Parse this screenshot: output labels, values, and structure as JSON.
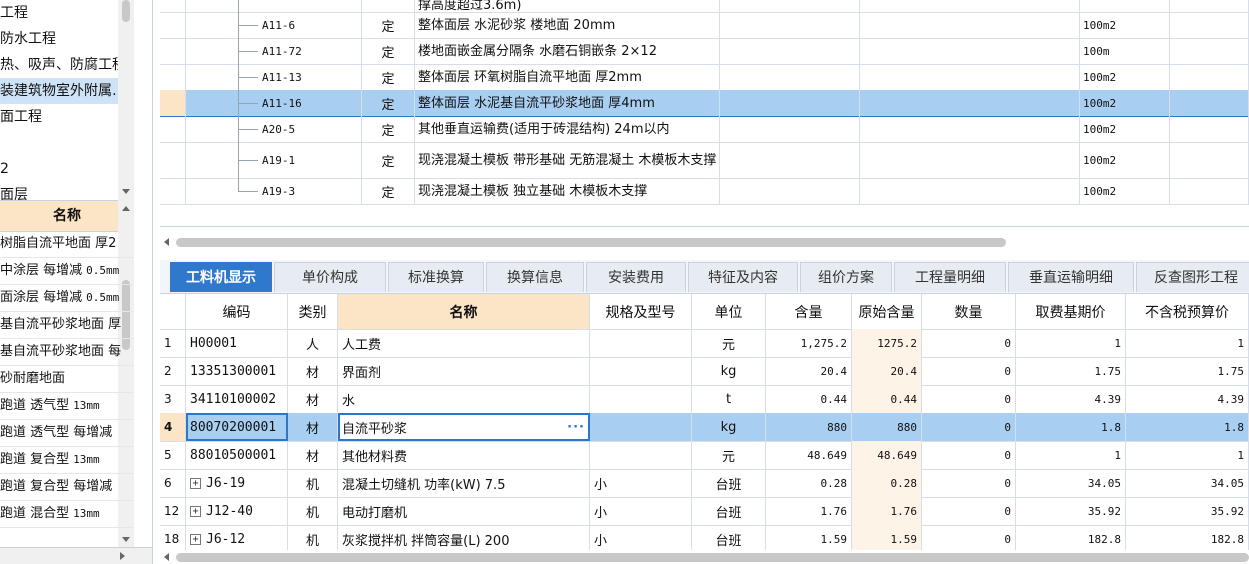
{
  "left_tree": {
    "items": [
      {
        "label": "工程",
        "selected": false
      },
      {
        "label": "防水工程",
        "selected": false
      },
      {
        "label": "热、吸声、防腐工程",
        "selected": false
      },
      {
        "label": "装建筑物室外附属…",
        "selected": true
      },
      {
        "label": "面工程",
        "selected": false
      },
      {
        "label": "",
        "selected": false
      },
      {
        "label": "2",
        "selected": false
      },
      {
        "label": "面层",
        "selected": false
      }
    ]
  },
  "left_list": {
    "header": "名称",
    "items": [
      {
        "text": "树脂自流平地面 厚2",
        "unit": ""
      },
      {
        "text": "中涂层 每增减",
        "unit": "0.5mm"
      },
      {
        "text": "面涂层 每增减",
        "unit": "0.5mm"
      },
      {
        "text": "基自流平砂浆地面 厚",
        "unit": ""
      },
      {
        "text": "基自流平砂浆地面 每",
        "unit": ""
      },
      {
        "text": "砂耐磨地面",
        "unit": ""
      },
      {
        "text": "跑道 透气型",
        "unit": "13mm"
      },
      {
        "text": "跑道 透气型 每增减",
        "unit": ""
      },
      {
        "text": "跑道 复合型",
        "unit": "13mm"
      },
      {
        "text": "跑道 复合型 每增减",
        "unit": ""
      },
      {
        "text": "跑道 混合型",
        "unit": "13mm"
      }
    ]
  },
  "top_grid": {
    "rows": [
      {
        "code": "",
        "type": "",
        "name": "撑高度超过3.6m)",
        "unit": "",
        "selected": false
      },
      {
        "code": "A11-6",
        "type": "定",
        "name": "整体面层 水泥砂浆 楼地面 20mm",
        "unit": "100m2",
        "selected": false
      },
      {
        "code": "A11-72",
        "type": "定",
        "name": "楼地面嵌金属分隔条 水磨石铜嵌条 2×12",
        "unit": "100m",
        "selected": false
      },
      {
        "code": "A11-13",
        "type": "定",
        "name": "整体面层 环氧树脂自流平地面 厚2mm",
        "unit": "100m2",
        "selected": false
      },
      {
        "code": "A11-16",
        "type": "定",
        "name": "整体面层 水泥基自流平砂浆地面 厚4mm",
        "unit": "100m2",
        "selected": true
      },
      {
        "code": "A20-5",
        "type": "定",
        "name": "其他垂直运输费(适用于砖混结构) 24m以内",
        "unit": "100m2",
        "selected": false
      },
      {
        "code": "A19-1",
        "type": "定",
        "name": "现浇混凝土模板 带形基础 无筋混凝土 木模板木支撑",
        "unit": "100m2",
        "selected": false
      },
      {
        "code": "A19-3",
        "type": "定",
        "name": "现浇混凝土模板 独立基础 木模板木支撑",
        "unit": "100m2",
        "selected": false
      }
    ]
  },
  "tabs": [
    {
      "label": "工料机显示",
      "active": true
    },
    {
      "label": "单价构成",
      "active": false
    },
    {
      "label": "标准换算",
      "active": false
    },
    {
      "label": "换算信息",
      "active": false
    },
    {
      "label": "安装费用",
      "active": false
    },
    {
      "label": "特征及内容",
      "active": false
    },
    {
      "label": "组价方案",
      "active": false
    },
    {
      "label": "工程量明细",
      "active": false
    },
    {
      "label": "垂直运输明细",
      "active": false
    },
    {
      "label": "反查图形工程",
      "active": false
    }
  ],
  "bottom_grid": {
    "headers": {
      "code": "编码",
      "category": "类别",
      "name": "名称",
      "spec": "规格及型号",
      "unit": "单位",
      "content": "含量",
      "orig_content": "原始含量",
      "qty": "数量",
      "base_price": "取费基期价",
      "pretax_price": "不含税预算价"
    },
    "rows": [
      {
        "num": "1",
        "expand": false,
        "code": "H00001",
        "category": "人",
        "name": "人工费",
        "spec": "",
        "unit": "元",
        "content": "1,275.2",
        "orig_content": "1275.2",
        "qty": "0",
        "base_price": "1",
        "pretax_price": "1",
        "selected": false
      },
      {
        "num": "2",
        "expand": false,
        "code": "13351300001",
        "category": "材",
        "name": "界面剂",
        "spec": "",
        "unit": "kg",
        "content": "20.4",
        "orig_content": "20.4",
        "qty": "0",
        "base_price": "1.75",
        "pretax_price": "1.75",
        "selected": false
      },
      {
        "num": "3",
        "expand": false,
        "code": "34110100002",
        "category": "材",
        "name": "水",
        "spec": "",
        "unit": "t",
        "content": "0.44",
        "orig_content": "0.44",
        "qty": "0",
        "base_price": "4.39",
        "pretax_price": "4.39",
        "selected": false
      },
      {
        "num": "4",
        "expand": false,
        "code": "80070200001",
        "category": "材",
        "name": "自流平砂浆",
        "spec": "",
        "unit": "kg",
        "content": "880",
        "orig_content": "880",
        "qty": "0",
        "base_price": "1.8",
        "pretax_price": "1.8",
        "selected": true
      },
      {
        "num": "5",
        "expand": false,
        "code": "88010500001",
        "category": "材",
        "name": "其他材料费",
        "spec": "",
        "unit": "元",
        "content": "48.649",
        "orig_content": "48.649",
        "qty": "0",
        "base_price": "1",
        "pretax_price": "1",
        "selected": false
      },
      {
        "num": "6",
        "expand": true,
        "code": "J6-19",
        "category": "机",
        "name": "混凝土切缝机 功率(kW) 7.5",
        "spec": "小",
        "unit": "台班",
        "content": "0.28",
        "orig_content": "0.28",
        "qty": "0",
        "base_price": "34.05",
        "pretax_price": "34.05",
        "selected": false
      },
      {
        "num": "12",
        "expand": true,
        "code": "J12-40",
        "category": "机",
        "name": "电动打磨机",
        "spec": "小",
        "unit": "台班",
        "content": "1.76",
        "orig_content": "1.76",
        "qty": "0",
        "base_price": "35.92",
        "pretax_price": "35.92",
        "selected": false
      },
      {
        "num": "18",
        "expand": true,
        "code": "J6-12",
        "category": "机",
        "name": "灰浆搅拌机 拌筒容量(L) 200",
        "spec": "小",
        "unit": "台班",
        "content": "1.59",
        "orig_content": "1.59",
        "qty": "0",
        "base_price": "182.8",
        "pretax_price": "182.8",
        "selected": false
      }
    ],
    "ellipsis": "···"
  },
  "colors": {
    "accent": "#2f78cc",
    "selection": "#a8cff2",
    "header_highlight": "#fce4c7"
  }
}
